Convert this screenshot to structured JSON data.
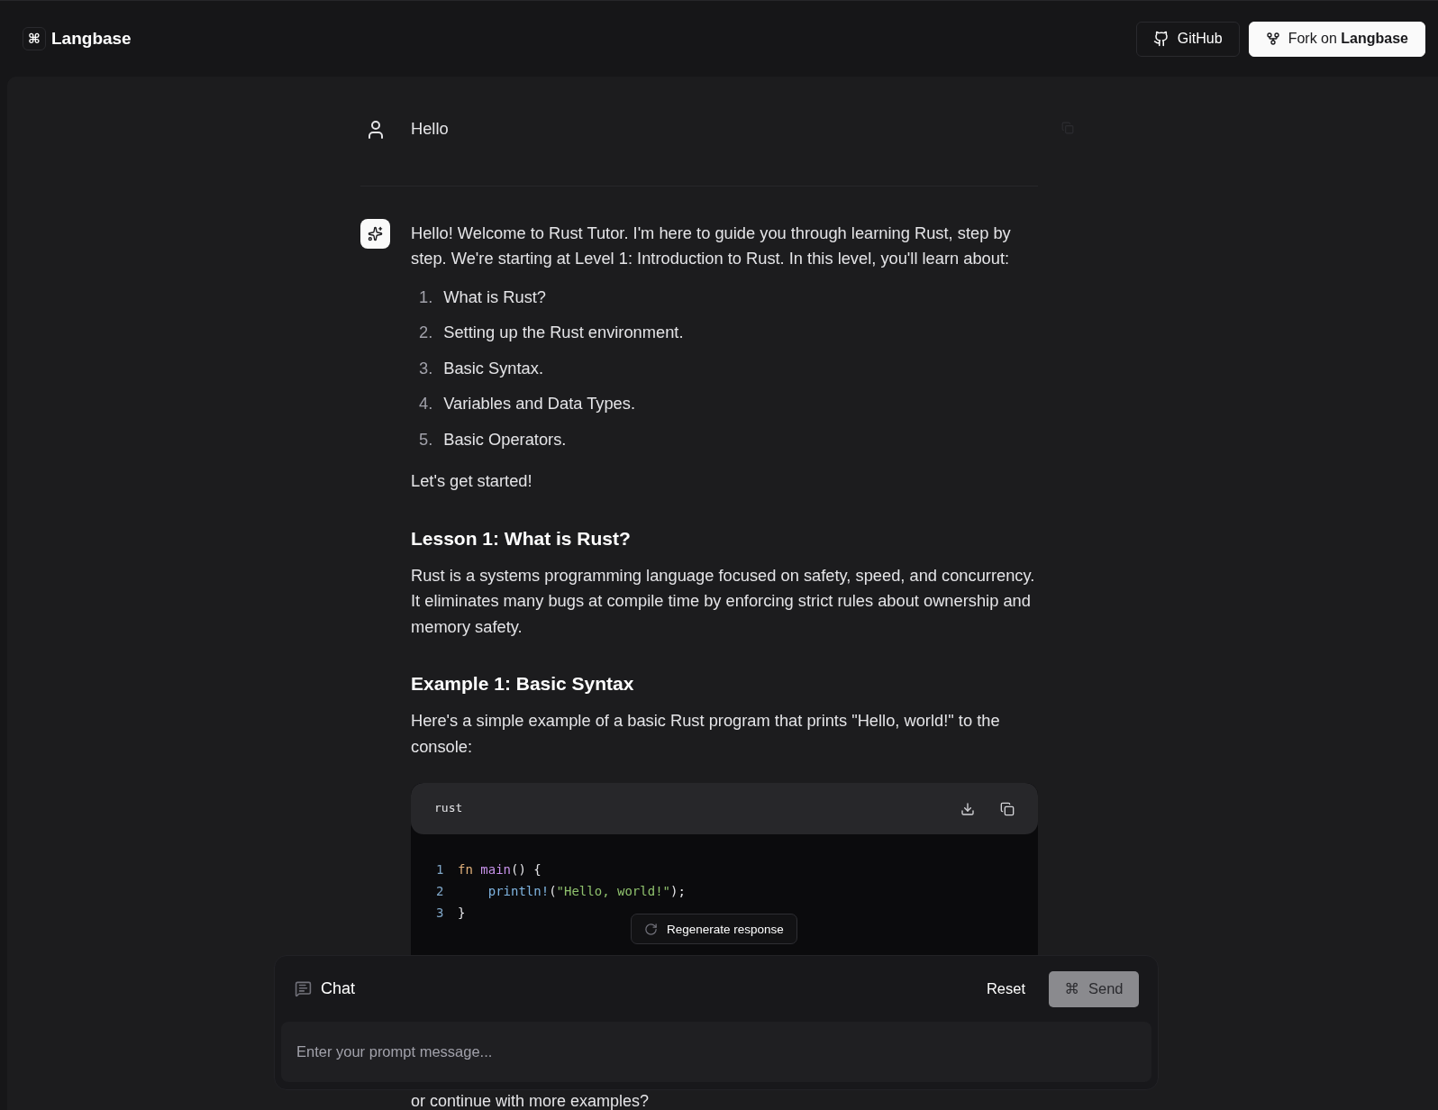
{
  "header": {
    "logo_glyph": "⌘",
    "brand": "Langbase",
    "github_button": "GitHub",
    "fork_button": "Fork on **Langbase**"
  },
  "messages": [
    {
      "kind": "user",
      "blocks": [
        {
          "kind": "paragraph",
          "text": "Hello"
        }
      ]
    },
    {
      "kind": "assistant",
      "blocks": [
        {
          "kind": "paragraph",
          "text": "Hello! Welcome to Rust Tutor. I'm here to guide you through learning Rust, step by step. We're starting at Level 1: Introduction to Rust. In this level, you'll learn about:"
        },
        {
          "kind": "list",
          "items": [
            {
              "number": "1.",
              "text": "What is Rust?"
            },
            {
              "number": "2.",
              "text": "Setting up the Rust environment."
            },
            {
              "number": "3.",
              "text": "Basic Syntax."
            },
            {
              "number": "4.",
              "text": "Variables and Data Types."
            },
            {
              "number": "5.",
              "text": "Basic Operators."
            }
          ]
        },
        {
          "kind": "paragraph",
          "text": "Let's get started!"
        },
        {
          "kind": "heading",
          "text": "Lesson 1: What is Rust?"
        },
        {
          "kind": "paragraph",
          "text": "Rust is a systems programming language focused on safety, speed, and concurrency. It eliminates many bugs at compile time by enforcing strict rules about ownership and memory safety."
        },
        {
          "kind": "heading",
          "text": "Example 1: Basic Syntax"
        },
        {
          "kind": "paragraph",
          "text": "Here's a simple example of a basic Rust program that prints \"Hello, world!\" to the console:"
        },
        {
          "kind": "code",
          "language": "rust",
          "lines": [
            {
              "number": "1",
              "indented": false,
              "tokens": [
                {
                  "kind": "keyword",
                  "text": "fn "
                },
                {
                  "kind": "function",
                  "text": "main"
                },
                {
                  "kind": "plain",
                  "text": "() {"
                }
              ]
            },
            {
              "number": "2",
              "indented": true,
              "tokens": [
                {
                  "kind": "macro",
                  "text": "println!"
                },
                {
                  "kind": "plain",
                  "text": "("
                },
                {
                  "kind": "string",
                  "text": "\"Hello, world!\""
                },
                {
                  "kind": "plain",
                  "text": ");"
                }
              ]
            },
            {
              "number": "3",
              "indented": false,
              "tokens": [
                {
                  "kind": "plain",
                  "text": "}"
                }
              ]
            }
          ]
        },
        {
          "kind": "trailing",
          "text": "or continue with more examples?"
        }
      ]
    }
  ],
  "regenerate_button": "Regenerate response",
  "chat": {
    "title": "Chat",
    "reset_button": "Reset",
    "send_glyph": "⌘",
    "send_button": "Send",
    "send_disabled": true,
    "placeholder": "Enter your prompt message..."
  }
}
